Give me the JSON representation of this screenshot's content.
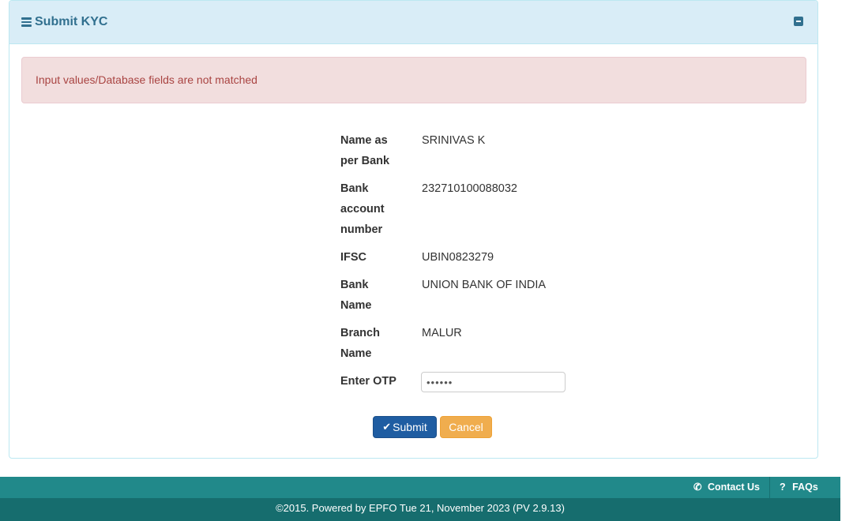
{
  "panel": {
    "title": "Submit KYC",
    "icon": "bars-icon",
    "collapse_icon": "minus-square-icon"
  },
  "alert": {
    "message": "Input values/Database fields are not matched"
  },
  "form": {
    "fields": [
      {
        "label_lines": [
          "Name as",
          "per Bank"
        ],
        "value": "SRINIVAS K"
      },
      {
        "label_lines": [
          "Bank",
          "account",
          "number"
        ],
        "value": "232710100088032"
      },
      {
        "label_lines": [
          "IFSC"
        ],
        "value": "UBIN0823279"
      },
      {
        "label_lines": [
          "Bank",
          "Name"
        ],
        "value": "UNION BANK OF INDIA"
      },
      {
        "label_lines": [
          "Branch",
          "Name"
        ],
        "value": "MALUR"
      }
    ],
    "otp_label": "Enter OTP",
    "otp_value": "••••••",
    "submit_label": "Submit",
    "cancel_label": "Cancel"
  },
  "footer": {
    "contact_label": "Contact Us",
    "faqs_label": "FAQs",
    "copyright": "©2015. Powered by EPFO Tue 21, November 2023 (PV 2.9.13)"
  },
  "colors": {
    "heading_bg": "#d9edf7",
    "heading_text": "#31708f",
    "alert_bg": "#f2dede",
    "alert_text": "#a94442",
    "submit_bg": "#1f5da2",
    "cancel_bg": "#f0ad4e",
    "footer_top": "#21898a",
    "footer_bottom": "#166d6e"
  }
}
